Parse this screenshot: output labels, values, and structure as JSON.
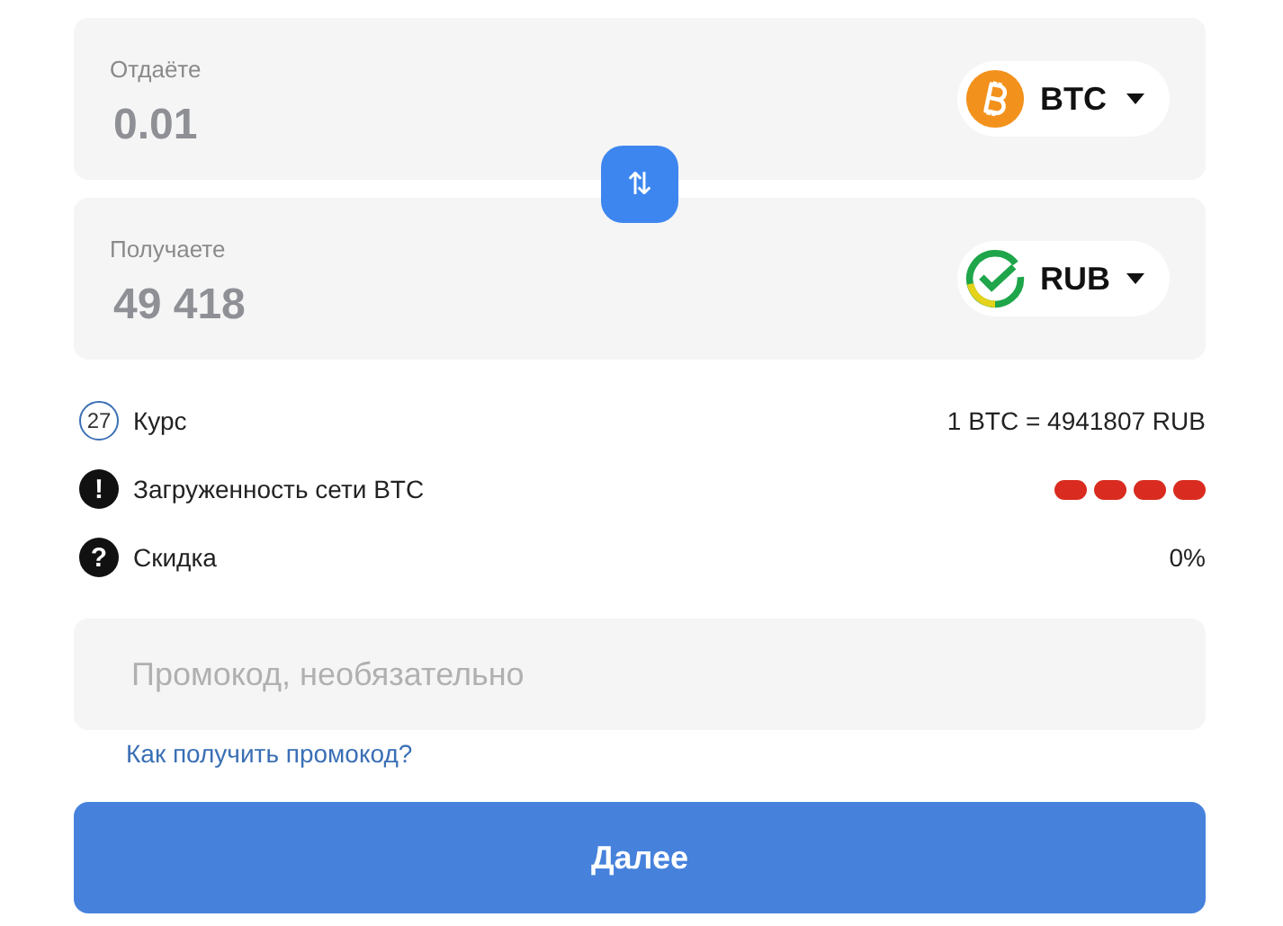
{
  "give": {
    "label": "Отдаёте",
    "value": "0.01",
    "currency": {
      "code": "BTC",
      "kind": "bitcoin"
    }
  },
  "receive": {
    "label": "Получаете",
    "value": "49 418",
    "currency": {
      "code": "RUB",
      "kind": "sber"
    }
  },
  "swap": {
    "icon": "⇅"
  },
  "info": [
    {
      "kind": "timer",
      "badge": "27",
      "label": "Курс",
      "value": "1 BTC = 4941807 RUB"
    },
    {
      "kind": "alert",
      "badge": "!",
      "label": "Загруженность сети BTC",
      "segments": [
        {
          "on": true
        },
        {
          "on": true
        },
        {
          "on": true
        },
        {
          "on": true
        }
      ]
    },
    {
      "kind": "help",
      "badge": "?",
      "label": "Скидка",
      "value": "0%"
    }
  ],
  "promo": {
    "placeholder": "Промокод, необязательно",
    "link": "Как получить промокод?"
  },
  "next_button": "Далее"
}
